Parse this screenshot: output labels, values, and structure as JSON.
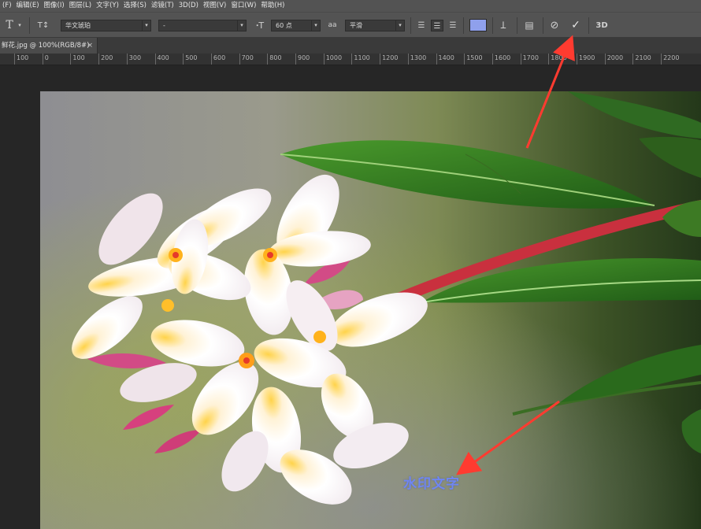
{
  "menu": [
    "(F)",
    "编辑(E)",
    "图像(I)",
    "图层(L)",
    "文字(Y)",
    "选择(S)",
    "滤镜(T)",
    "3D(D)",
    "视图(V)",
    "窗口(W)",
    "帮助(H)"
  ],
  "options_bar": {
    "tool_icon": "T",
    "orientation_icon": "T↕",
    "font_family": "华文琥珀",
    "font_style": "-",
    "font_size": "60 点",
    "aa_icon": "aa",
    "antialias": "平滑",
    "text_color": "#8fa0ec",
    "commit_mark": "✓",
    "cancel_mark": "⃠",
    "three_d": "3D"
  },
  "document_tab": {
    "title": "鲜花.jpg @ 100%(RGB/8#)",
    "close": "×"
  },
  "ruler": {
    "labels": [
      "100",
      "0",
      "100",
      "200",
      "300",
      "400",
      "500",
      "600",
      "700",
      "800",
      "900",
      "1000",
      "1100",
      "1200",
      "1300",
      "1400",
      "1500",
      "1600",
      "1700",
      "1800",
      "1900",
      "2000",
      "2100",
      "2200"
    ]
  },
  "canvas": {
    "watermark_text": "水印文字",
    "annotation_color": "#ff3b30"
  }
}
